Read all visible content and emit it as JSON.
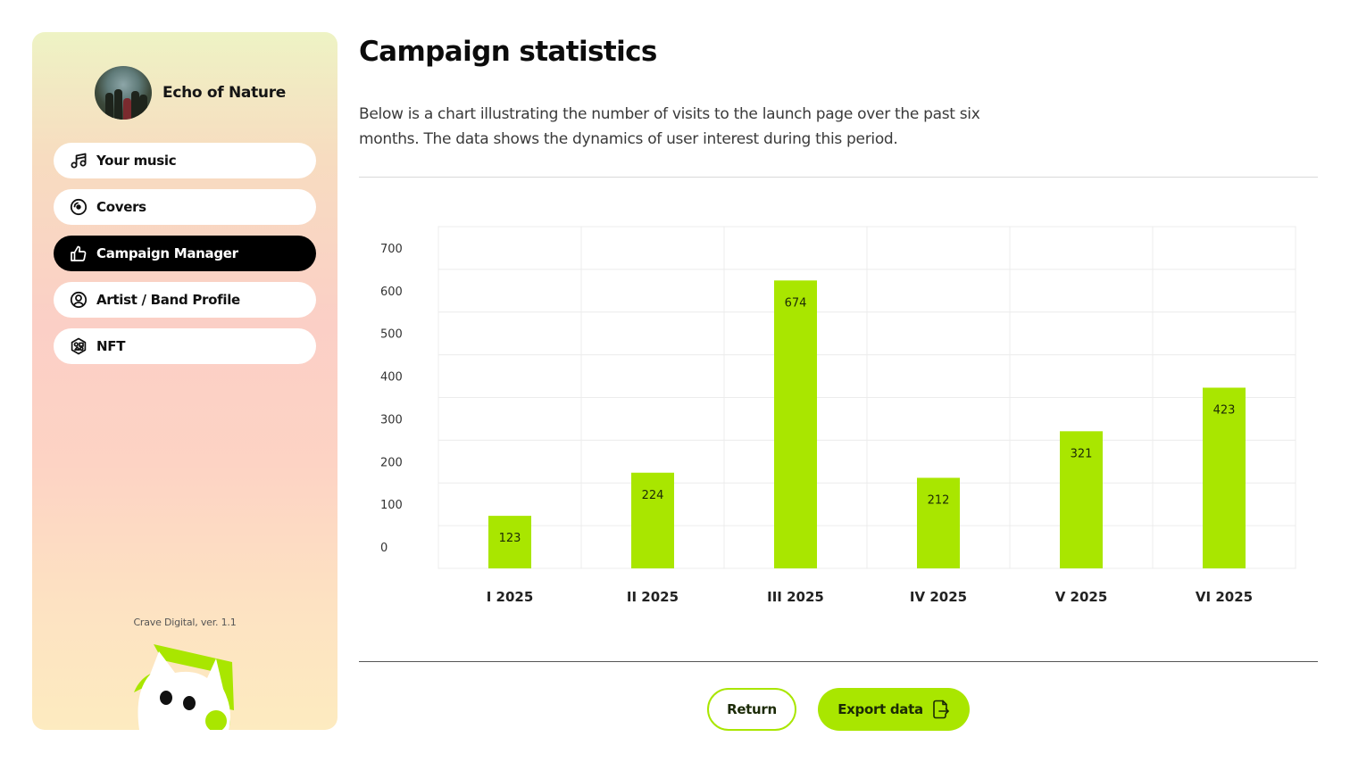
{
  "sidebar": {
    "profile": {
      "name": "Echo of Nature"
    },
    "items": [
      {
        "label": "Your music",
        "icon": "music-note-icon",
        "active": false
      },
      {
        "label": "Covers",
        "icon": "disc-icon",
        "active": false
      },
      {
        "label": "Campaign Manager",
        "icon": "thumbs-up-icon",
        "active": true
      },
      {
        "label": "Artist / Band Profile",
        "icon": "user-circle-icon",
        "active": false
      },
      {
        "label": "NFT",
        "icon": "nft-hexagon-icon",
        "active": false
      }
    ],
    "version": "Crave Digital, ver. 1.1"
  },
  "main": {
    "title": "Campaign statistics",
    "description": "Below is a chart illustrating the number of visits to the launch page over the past six months. The data shows the dynamics of user interest during this period."
  },
  "chart_data": {
    "type": "bar",
    "categories": [
      "I 2025",
      "II 2025",
      "III 2025",
      "IV 2025",
      "V 2025",
      "VI 2025"
    ],
    "values": [
      123,
      224,
      674,
      212,
      321,
      423
    ],
    "yticks": [
      0,
      100,
      200,
      300,
      400,
      500,
      600,
      700
    ],
    "ylim": [
      0,
      800
    ],
    "grid": true,
    "bar_color": "#a9e600",
    "title": "",
    "xlabel": "",
    "ylabel": ""
  },
  "actions": {
    "return_label": "Return",
    "export_label": "Export data"
  },
  "colors": {
    "accent": "#a9e600",
    "active_nav": "#000000"
  }
}
